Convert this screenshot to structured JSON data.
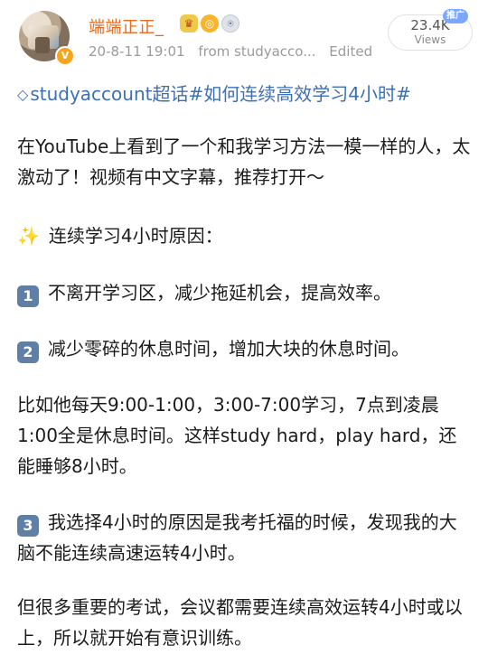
{
  "post": {
    "username": "端端正正_",
    "badges": [
      "crown-badge",
      "donut-badge",
      "medal-badge"
    ],
    "timestamp": "20-8-11 19:01",
    "source": "from studyacco...",
    "edited": "Edited",
    "views_count": "23.4K",
    "views_label": "Views",
    "promo": "推广",
    "topic_line": "studyaccount超话#如何连续高效学习4小时#",
    "intro": "在YouTube上看到了一个和我学习方法一模一样的人，太激动了！视频有中文字幕，推荐打开～",
    "reasons_heading": "连续学习4小时原因：",
    "point1_num": "1",
    "point1": "不离开学习区，减少拖延机会，提高效率。",
    "point2_num": "2",
    "point2": "减少零碎的休息时间，增加大块的休息时间。",
    "example": "比如他每天9:00-1:00，3:00-7:00学习，7点到凌晨1:00全是休息时间。这样study hard，play hard，还能睡够8小时。",
    "point3_num": "3",
    "point3": "我选择4小时的原因是我考托福的时候，发现我的大脑不能连续高速运转4小时。",
    "closing": "但很多重要的考试，会议都需要连续高效运转4小时或以上，所以就开始有意识训练。"
  },
  "colors": {
    "username": "#e86a1f",
    "topic": "#3d6fb5",
    "meta": "#9b9b9b",
    "keycap": "#5f7fa6",
    "promo": "#7ca7ff"
  }
}
